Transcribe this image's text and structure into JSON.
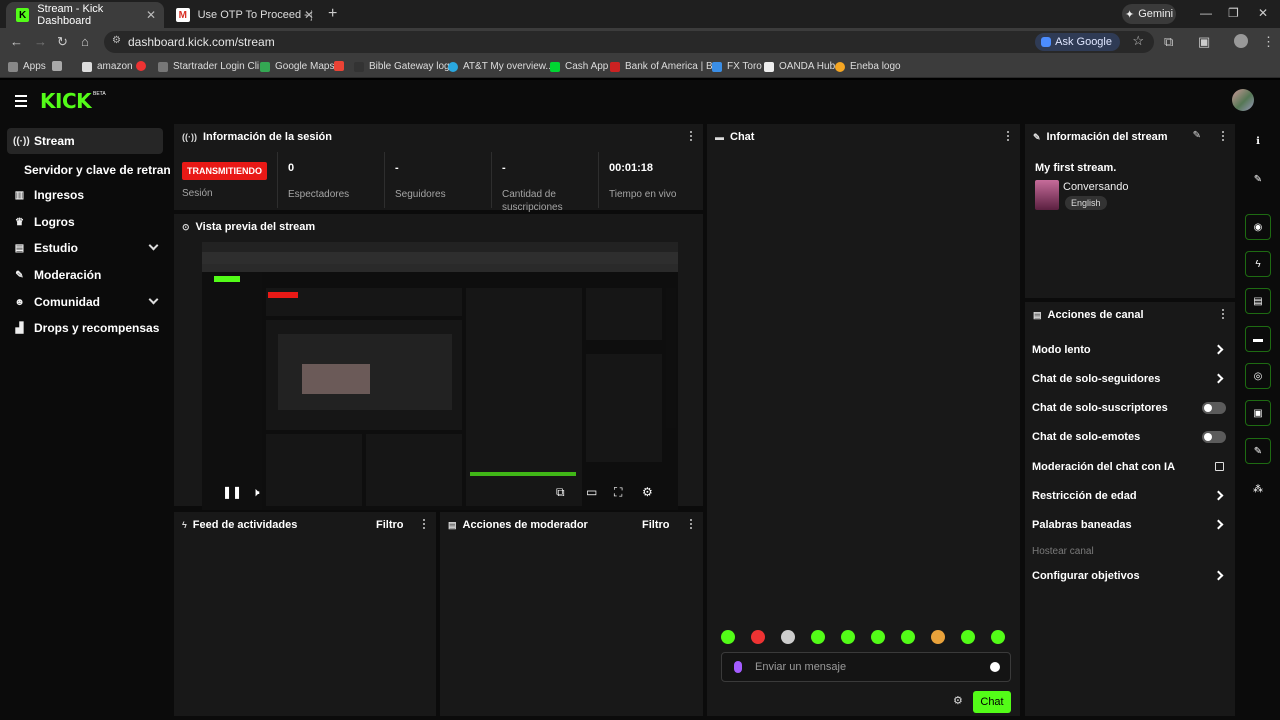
{
  "browser": {
    "tabs": [
      {
        "title": "Stream - Kick Dashboard",
        "active": true
      },
      {
        "title": "Use OTP To Proceed - justoluis",
        "active": false
      }
    ],
    "gemini": "Gemini",
    "url": "dashboard.kick.com/stream",
    "ask": "Ask Google",
    "bookmarks": [
      "Apps",
      "amazon",
      "Startrader Login Cli...",
      "Google Maps",
      "Bible Gateway logo",
      "AT&T My overview...",
      "Cash App",
      "Bank of America | B...",
      "FX Toro",
      "OANDA Hub",
      "Eneba logo"
    ]
  },
  "kick": {
    "logo": "KICK",
    "beta": "BETA",
    "accent": "#53fc18"
  },
  "sidebar": {
    "items": [
      {
        "label": "Stream",
        "icon": "broadcast-icon"
      },
      {
        "label": "Servidor y clave de retransm",
        "icon": ""
      },
      {
        "label": "Ingresos",
        "icon": "chart-icon"
      },
      {
        "label": "Logros",
        "icon": "trophy-icon"
      },
      {
        "label": "Estudio",
        "icon": "studio-icon"
      },
      {
        "label": "Moderación",
        "icon": "wrench-icon"
      },
      {
        "label": "Comunidad",
        "icon": "people-icon"
      },
      {
        "label": "Drops y recompensas",
        "icon": "drops-icon"
      }
    ]
  },
  "session": {
    "title": "Información de la sesión",
    "badge": "TRANSMITIENDO",
    "session_label": "Sesión",
    "viewers_value": "0",
    "viewers_label": "Espectadores",
    "followers_value": "-",
    "followers_label": "Seguidores",
    "subs_value": "-",
    "subs_label": "Cantidad de suscripciones",
    "uptime_value": "00:01:18",
    "uptime_label": "Tiempo en vivo"
  },
  "preview": {
    "title": "Vista previa del stream"
  },
  "feed": {
    "title": "Feed de actividades",
    "filter": "Filtro"
  },
  "modactions": {
    "title": "Acciones de moderador",
    "filter": "Filtro"
  },
  "chat": {
    "title": "Chat",
    "placeholder": "Enviar un mensaje",
    "send": "Chat"
  },
  "streaminfo": {
    "title": "Información del stream",
    "stream_title": "My first stream.",
    "category": "Conversando",
    "language": "English"
  },
  "channel_actions": {
    "title": "Acciones de canal",
    "items": [
      {
        "label": "Modo lento",
        "kind": "arrow"
      },
      {
        "label": "Chat de solo-seguidores",
        "kind": "arrow"
      },
      {
        "label": "Chat de solo-suscriptores",
        "kind": "toggle"
      },
      {
        "label": "Chat de solo-emotes",
        "kind": "toggle"
      },
      {
        "label": "Moderación del chat con IA",
        "kind": "external"
      },
      {
        "label": "Restricción de edad",
        "kind": "arrow"
      },
      {
        "label": "Palabras baneadas",
        "kind": "arrow"
      },
      {
        "label": "Hostear canal",
        "kind": "disabled"
      },
      {
        "label": "Configurar objetivos",
        "kind": "arrow"
      }
    ]
  }
}
